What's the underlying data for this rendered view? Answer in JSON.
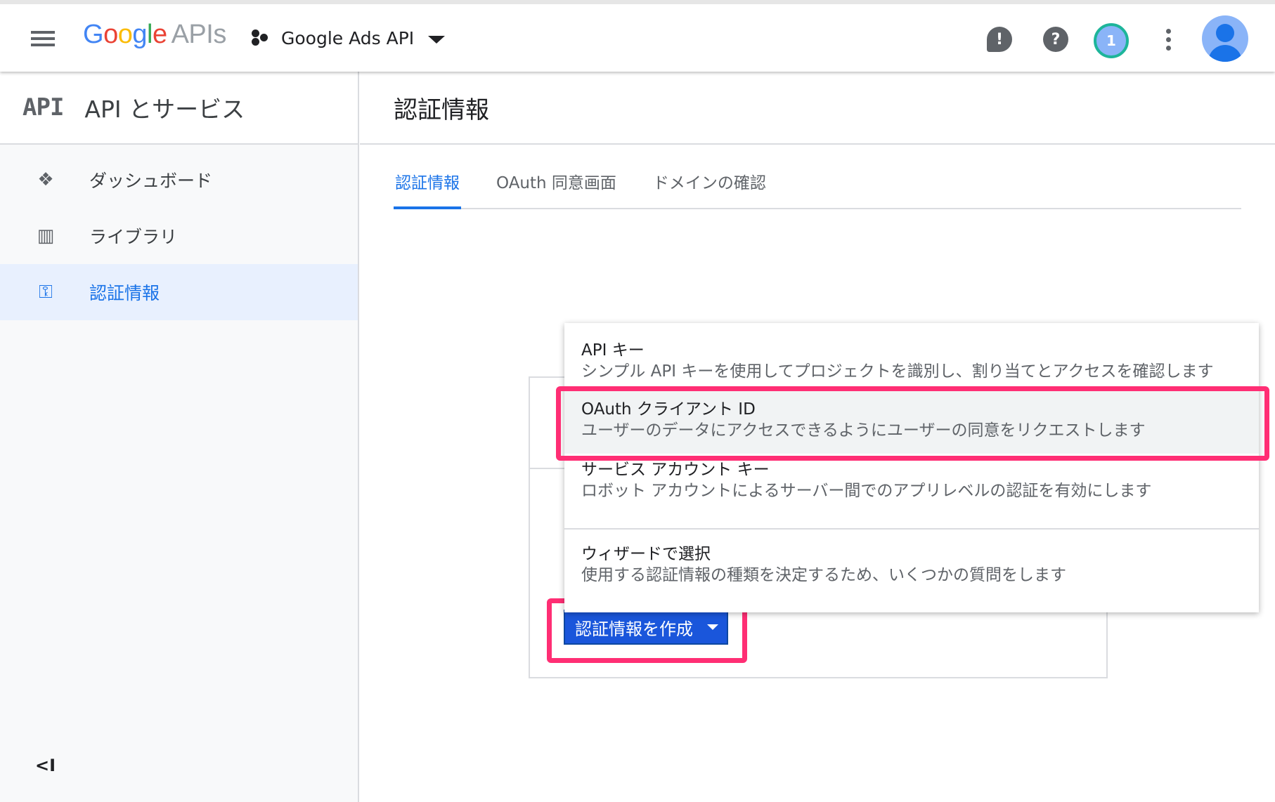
{
  "header": {
    "logo_letters": [
      "G",
      "o",
      "o",
      "g",
      "l",
      "e"
    ],
    "logo_apis": "APIs",
    "project_name": "Google Ads API",
    "notification_count": "1",
    "feedback_glyph": "!",
    "help_glyph": "?",
    "icons": [
      "menu-icon",
      "feedback-icon",
      "help-icon",
      "notifications-icon",
      "more-vert-icon",
      "account-avatar-icon"
    ]
  },
  "sidebar": {
    "badge": "API",
    "title": "API とサービス",
    "items": [
      {
        "label": "ダッシュボード",
        "icon": "dashboard-icon",
        "glyph": "❖"
      },
      {
        "label": "ライブラリ",
        "icon": "library-icon",
        "glyph": "▥"
      },
      {
        "label": "認証情報",
        "icon": "key-icon",
        "glyph": "⚿",
        "active": true
      }
    ],
    "collapse_glyph": "<I"
  },
  "main": {
    "title": "認証情報",
    "tabs": [
      {
        "label": "認証情報",
        "active": true
      },
      {
        "label": "OAuth 同意画面"
      },
      {
        "label": "ドメインの確認"
      }
    ],
    "create_button": "認証情報を作成"
  },
  "menu": {
    "items": [
      {
        "title": "API キー",
        "desc": "シンプル API キーを使用してプロジェクトを識別し、割り当てとアクセスを確認します"
      },
      {
        "title": "OAuth クライアント ID",
        "desc": "ユーザーのデータにアクセスできるようにユーザーの同意をリクエストします",
        "highlighted": true
      },
      {
        "title": "サービス アカウント キー",
        "desc": "ロボット アカウントによるサーバー間でのアプリレベルの認証を有効にします"
      },
      {
        "title": "ウィザードで選択",
        "desc": "使用する認証情報の種類を決定するため、いくつかの質問をします"
      }
    ]
  },
  "colors": {
    "accent": "#1a73e8",
    "button": "#1a56db",
    "highlight": "#ff2e74"
  }
}
